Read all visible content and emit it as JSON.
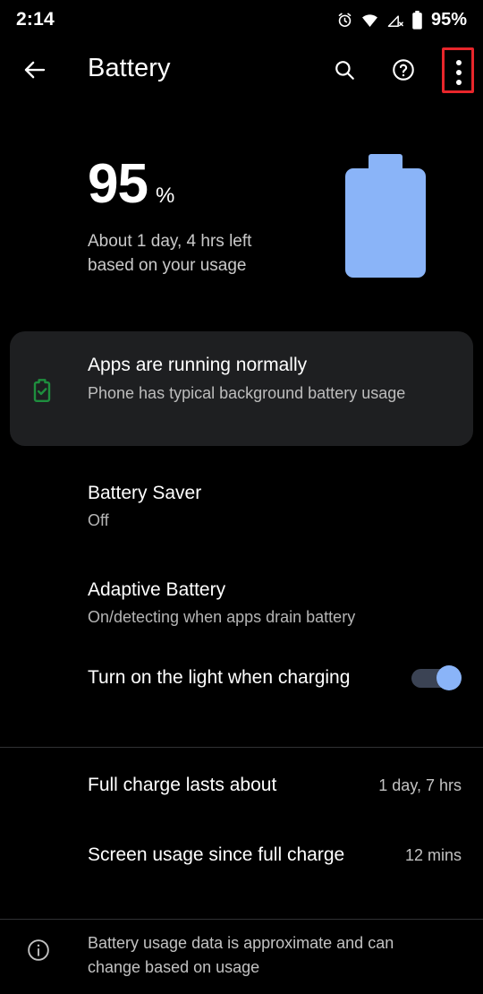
{
  "status_bar": {
    "time": "2:14",
    "battery_percent": "95%",
    "icons": [
      "alarm-icon",
      "wifi-icon",
      "cellular-no-sim-icon",
      "battery-icon"
    ]
  },
  "app_bar": {
    "title": "Battery",
    "back_icon": "back-arrow-icon",
    "actions": [
      {
        "name": "search-icon",
        "label": "Search"
      },
      {
        "name": "help-icon",
        "label": "Help"
      },
      {
        "name": "overflow-menu-icon",
        "label": "More options"
      }
    ],
    "highlighted_action": "overflow-menu-icon",
    "highlight_color": "#e8262b"
  },
  "battery_summary": {
    "percent": "95",
    "percent_sign": "%",
    "estimate_line1": "About 1 day, 4 hrs left",
    "estimate_line2": "based on your usage",
    "graphic_color": "#8ab4f8"
  },
  "status_card": {
    "icon": "battery-check-icon",
    "icon_color": "#1e8e3e",
    "title": "Apps are running normally",
    "subtitle": "Phone has typical background battery usage",
    "background": "#1e1f21"
  },
  "settings": [
    {
      "name": "battery-saver",
      "title": "Battery Saver",
      "subtitle": "Off"
    },
    {
      "name": "adaptive-battery",
      "title": "Adaptive Battery",
      "subtitle": "On/detecting when apps drain battery"
    },
    {
      "name": "charging-light",
      "title": "Turn on the light when charging",
      "toggle_state": "on"
    }
  ],
  "stats": [
    {
      "name": "full-charge-lasts",
      "title": "Full charge lasts about",
      "value": "1 day, 7 hrs"
    },
    {
      "name": "screen-usage",
      "title": "Screen usage since full charge",
      "value": "12 mins"
    }
  ],
  "footer": {
    "icon": "info-icon",
    "text": "Battery usage data is approximate and can change based on usage"
  }
}
